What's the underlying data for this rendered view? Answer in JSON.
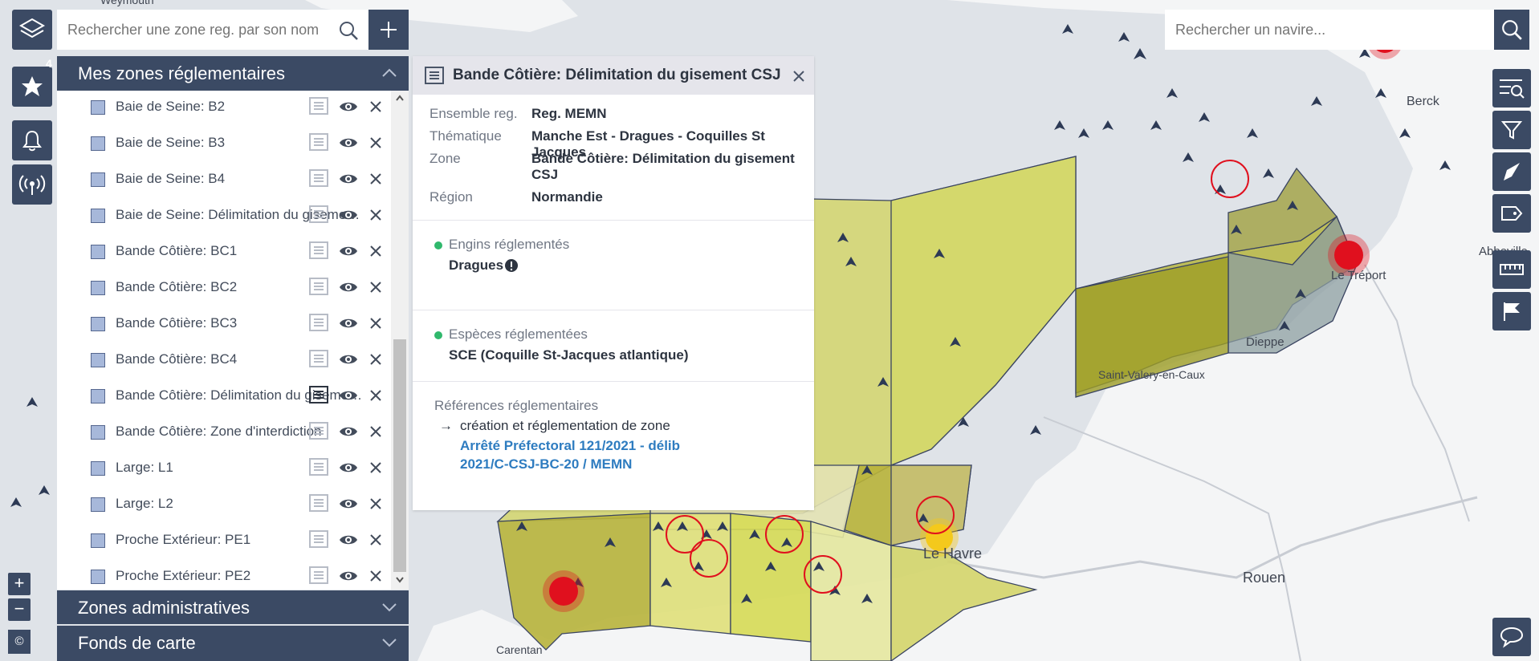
{
  "left": {
    "search_placeholder": "Rechercher une zone reg. par son nom",
    "favorites_count": "4",
    "my_zones_title": "Mes zones réglementaires",
    "zones": [
      {
        "label": "Baie de Seine: B2"
      },
      {
        "label": "Baie de Seine: B3"
      },
      {
        "label": "Baie de Seine: B4"
      },
      {
        "label": "Baie de Seine: Délimitation du gisement CSJ"
      },
      {
        "label": "Bande Côtière: BC1"
      },
      {
        "label": "Bande Côtière: BC2"
      },
      {
        "label": "Bande Côtière: BC3"
      },
      {
        "label": "Bande Côtière: BC4"
      },
      {
        "label": "Bande Côtière: Délimitation du gisement CSJ"
      },
      {
        "label": "Bande Côtière: Zone d'interdiction"
      },
      {
        "label": "Large: L1"
      },
      {
        "label": "Large: L2"
      },
      {
        "label": "Proche Extérieur: PE1"
      },
      {
        "label": "Proche Extérieur: PE2"
      }
    ],
    "admin_zones_title": "Zones administratives",
    "basemap_title": "Fonds de carte",
    "zoom_in": "+",
    "zoom_out": "−",
    "copyright": "©"
  },
  "popup": {
    "title": "Bande Côtière: Délimitation du gisement CSJ",
    "rows": [
      {
        "key": "Ensemble reg.",
        "value": "Reg. MEMN"
      },
      {
        "key": "Thématique",
        "value": "Manche Est - Dragues - Coquilles St Jacques"
      },
      {
        "key": "Zone",
        "value": "Bande Côtière: Délimitation du gisement CSJ"
      },
      {
        "key": "Région",
        "value": "Normandie"
      }
    ],
    "gears_title": "Engins réglementés",
    "gears_value": "Dragues",
    "species_title": "Espèces réglementées",
    "species_value": "SCE (Coquille St-Jacques atlantique)",
    "refs_title": "Références réglementaires",
    "refs_arrow": "→",
    "refs_item": "création et réglementation de zone",
    "refs_link": "Arrêté Préfectoral 121/2021 - délib 2021/C-CSJ-BC-20 / MEMN"
  },
  "right": {
    "ship_search_placeholder": "Rechercher un navire..."
  },
  "map_labels": {
    "weymouth": "Weymouth",
    "berck": "Berck",
    "abbeville": "Abbeville",
    "le_treport": "Le Tréport",
    "dieppe": "Dieppe",
    "saint_valery": "Saint-Valery-en-Caux",
    "le_havre": "Le Havre",
    "rouen": "Rouen",
    "carentan": "Carentan"
  },
  "colors": {
    "panel_dark": "#3b4a64",
    "link": "#2e7cc0",
    "green_dot": "#30b86c",
    "alert_red": "#e0101e",
    "alert_yellow": "#f4c91c"
  }
}
